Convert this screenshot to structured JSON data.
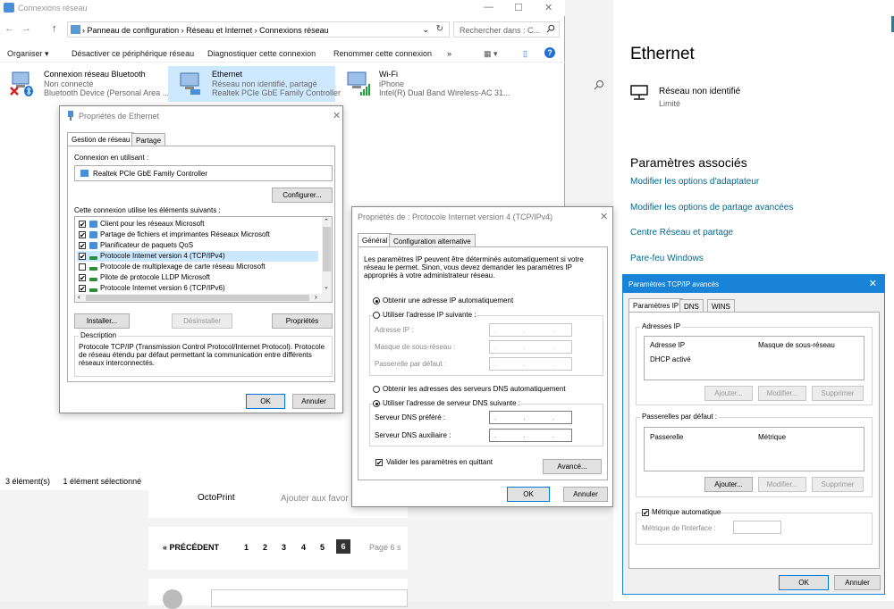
{
  "browser_bg": {
    "card1_name": "OctoPrint",
    "card1_link": "Ajouter aux favor",
    "pager_prev": "« PRÉCÉDENT",
    "pages": [
      "1",
      "2",
      "3",
      "4",
      "5",
      "6"
    ],
    "active_page": "6",
    "page_info": "Page 6 s"
  },
  "settings": {
    "title": "Ethernet",
    "network_name": "Réseau non identifié",
    "network_sub": "Limité",
    "related_heading": "Paramètres associés",
    "links": [
      "Modifier les options d'adaptateur",
      "Modifier les options de partage avancées",
      "Centre Réseau et partage",
      "Pare-feu Windows"
    ]
  },
  "explorer": {
    "title": "Connexions réseau",
    "window_controls": [
      "—",
      "☐",
      "✕"
    ],
    "nav": [
      "←",
      "→",
      "↑"
    ],
    "breadcrumb": "›  Panneau de configuration  ›  Réseau et Internet  ›  Connexions réseau",
    "address_dropdown": "⌄",
    "refresh": "↻",
    "search_placeholder": "Rechercher dans : C...",
    "commands": [
      "Organiser ▾",
      "Désactiver ce périphérique réseau",
      "Diagnostiquer cette connexion",
      "Renommer cette connexion",
      "»"
    ],
    "view_icons": [
      "▦ ▾",
      "▯"
    ],
    "help": "?",
    "items": [
      {
        "name": "Connexion réseau Bluetooth",
        "line1": "Non connecté",
        "line2": "Bluetooth Device (Personal Area ..."
      },
      {
        "name": "Ethernet",
        "line1": "Réseau non identifié, partagé",
        "line2": "Realtek PCIe GbE Family Controller"
      },
      {
        "name": "Wi-Fi",
        "line1": "iPhone",
        "line2": "Intel(R) Dual Band Wireless-AC 31..."
      }
    ],
    "status_count": "3 élément(s)",
    "status_selected": "1 élément sélectionné"
  },
  "eth_props": {
    "title": "Propriétés de Ethernet",
    "tabs": [
      "Gestion de réseau",
      "Partage"
    ],
    "connect_using_label": "Connexion en utilisant :",
    "adapter": "Realtek PCIe GbE Family Controller",
    "configure_btn": "Configurer...",
    "items_label": "Cette connexion utilise les éléments suivants :",
    "items": [
      {
        "label": "Client pour les réseaux Microsoft",
        "checked": "✔"
      },
      {
        "label": "Partage de fichiers et imprimantes Réseaux Microsoft",
        "checked": "✔"
      },
      {
        "label": "Planificateur de paquets QoS",
        "checked": "✔"
      },
      {
        "label": "Protocole Internet version 4 (TCP/IPv4)",
        "checked": "✔"
      },
      {
        "label": "Protocole de multiplexage de carte réseau Microsoft",
        "checked": ""
      },
      {
        "label": "Pilote de protocole LLDP Microsoft",
        "checked": "✔"
      },
      {
        "label": "Protocole Internet version 6 (TCP/IPv6)",
        "checked": "✔"
      }
    ],
    "install_btn": "Installer...",
    "uninstall_btn": "Désinstaller",
    "props_btn": "Propriétés",
    "desc_title": "Description",
    "description": "Protocole TCP/IP (Transmission Control Protocol/Internet Protocol). Protocole de réseau étendu par défaut permettant la communication entre différents réseaux interconnectés.",
    "ok": "OK",
    "cancel": "Annuler"
  },
  "ipv4": {
    "title": "Propriétés de : Protocole Internet version 4 (TCP/IPv4)",
    "tabs": [
      "Général",
      "Configuration alternative"
    ],
    "intro": "Les paramètres IP peuvent être déterminés automatiquement si votre réseau le permet. Sinon, vous devez demander les paramètres IP appropriés à votre administrateur réseau.",
    "auto_ip": "Obtenir une adresse IP automatiquement",
    "manual_ip": "Utiliser l'adresse IP suivante :",
    "ip_label": "Adresse IP :",
    "mask_label": "Masque de sous-réseau :",
    "gw_label": "Passerelle par défaut :",
    "auto_dns": "Obtenir les adresses des serveurs DNS automatiquement",
    "manual_dns": "Utiliser l'adresse de serveur DNS suivante :",
    "dns1_label": "Serveur DNS préféré :",
    "dns2_label": "Serveur DNS auxiliaire :",
    "ip_field": ". . .",
    "validate": "Valider les paramètres en quittant",
    "advanced_btn": "Avancé...",
    "ok": "OK",
    "cancel": "Annuler"
  },
  "advanced": {
    "title": "Paramètres TCP/IP avancés",
    "tabs": [
      "Paramètres IP",
      "DNS",
      "WINS"
    ],
    "ip_group": "Adresses IP",
    "col_ip": "Adresse IP",
    "col_mask": "Masque de sous-réseau",
    "dhcp": "DHCP activé",
    "gw_group": "Passerelles par défaut :",
    "col_gw": "Passerelle",
    "col_metric": "Métrique",
    "add_btn": "Ajouter...",
    "edit_btn": "Modifier...",
    "delete_btn": "Supprimer",
    "auto_metric": "Métrique automatique",
    "iface_metric": "Métrique de l'interface :",
    "ok": "OK",
    "cancel": "Annuler"
  }
}
